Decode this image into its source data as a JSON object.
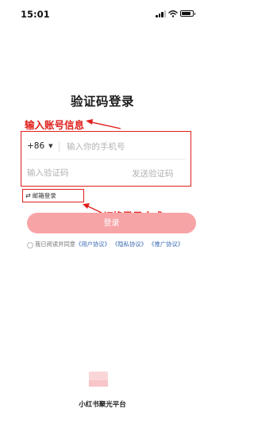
{
  "status_bar": {
    "time": "15:01"
  },
  "page": {
    "title": "验证码登录"
  },
  "annotations": {
    "input_account": "输入账号信息",
    "switch_method": "切换登录方式"
  },
  "form": {
    "country_code": "+86",
    "phone_placeholder": "输入你的手机号",
    "code_placeholder": "输入验证码",
    "send_code_label": "发送验证码",
    "switch_login_label": "邮箱登录",
    "login_button_label": "登录"
  },
  "agreement": {
    "prefix": "我已阅读并同意",
    "user_agreement": "《用户协议》",
    "privacy_agreement": "《隐私协议》",
    "promotion_agreement": "《推广协议》"
  },
  "footer": {
    "brand": "小红书聚光平台"
  },
  "colors": {
    "accent_red": "#e0201c",
    "button_pink": "#f7a4a7",
    "link_blue": "#3b6bb5"
  },
  "icons": [
    "signal-icon",
    "wifi-icon",
    "battery-icon",
    "chevron-down-icon",
    "switch-arrows-icon",
    "checkbox-icon",
    "logo-icon"
  ]
}
